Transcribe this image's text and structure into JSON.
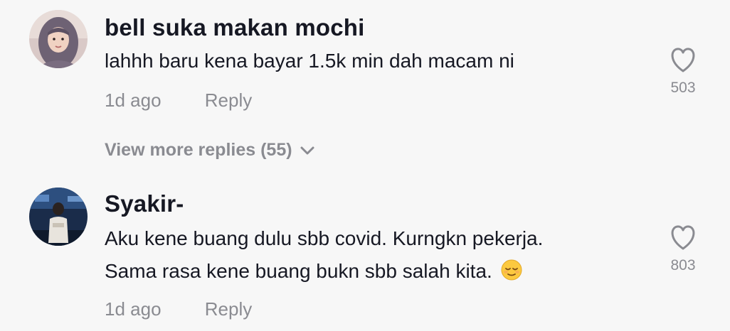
{
  "comments": [
    {
      "username": "bell suka makan mochi",
      "text_lines": [
        "lahhh baru kena bayar 1.5k min dah macam ni"
      ],
      "time": "1d ago",
      "reply_label": "Reply",
      "likes": "503",
      "avatar_icon": "user-avatar-hijab"
    },
    {
      "username": "Syakir-",
      "text_lines": [
        "Aku kene buang dulu sbb covid. Kurngkn pekerja.",
        "Sama rasa kene buang bukn sbb salah kita."
      ],
      "emoji": "relieved-face-emoji",
      "time": "1d ago",
      "reply_label": "Reply",
      "likes": "803",
      "avatar_icon": "user-avatar-photo"
    }
  ],
  "view_more": {
    "label": "View more replies (55)"
  },
  "colors": {
    "background": "#f7f7f7",
    "text_primary": "#161823",
    "text_secondary": "#8a8b91"
  }
}
